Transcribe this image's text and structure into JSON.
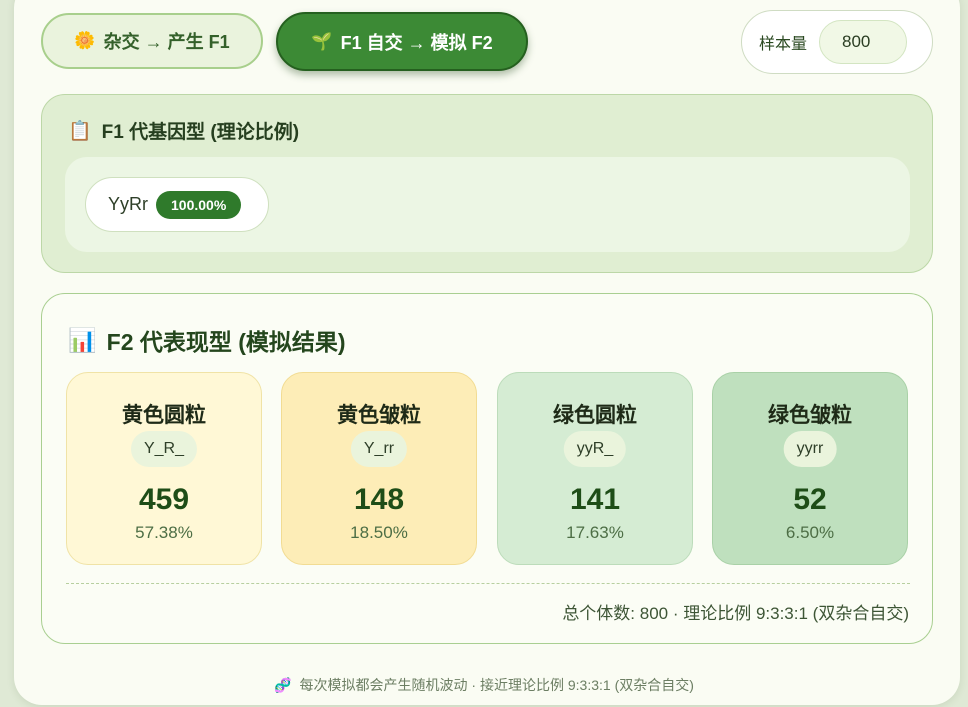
{
  "tabs": [
    {
      "icon": "🌼",
      "label": "杂交 → 产生 F1",
      "active": false
    },
    {
      "icon": "🌱",
      "label": "F1 自交 → 模拟 F2",
      "active": true
    }
  ],
  "sample": {
    "label": "样本量",
    "value": "800"
  },
  "f1": {
    "icon": "📋",
    "title": "F1 代基因型 (理论比例)",
    "genotypes": [
      {
        "name": "YyRr",
        "pct": "100.00%"
      }
    ]
  },
  "f2": {
    "icon": "📊",
    "title": "F2 代表现型 (模拟结果)",
    "phenotypes": [
      {
        "name": "黄色圆粒",
        "genotype": "Y_R_",
        "count": "459",
        "pct": "57.38%"
      },
      {
        "name": "黄色皱粒",
        "genotype": "Y_rr",
        "count": "148",
        "pct": "18.50%"
      },
      {
        "name": "绿色圆粒",
        "genotype": "yyR_",
        "count": "141",
        "pct": "17.63%"
      },
      {
        "name": "绿色皱粒",
        "genotype": "yyrr",
        "count": "52",
        "pct": "6.50%"
      }
    ],
    "summary": "总个体数: 800 · 理论比例 9:3:3:1 (双杂合自交)"
  },
  "footer": {
    "icon": "🧬",
    "text": "每次模拟都会产生随机波动 · 接近理论比例 9:3:3:1 (双杂合自交)"
  },
  "colors": {
    "accent": "#3c8a35",
    "panel": "#e0eed2",
    "background": "#fafcf3"
  }
}
